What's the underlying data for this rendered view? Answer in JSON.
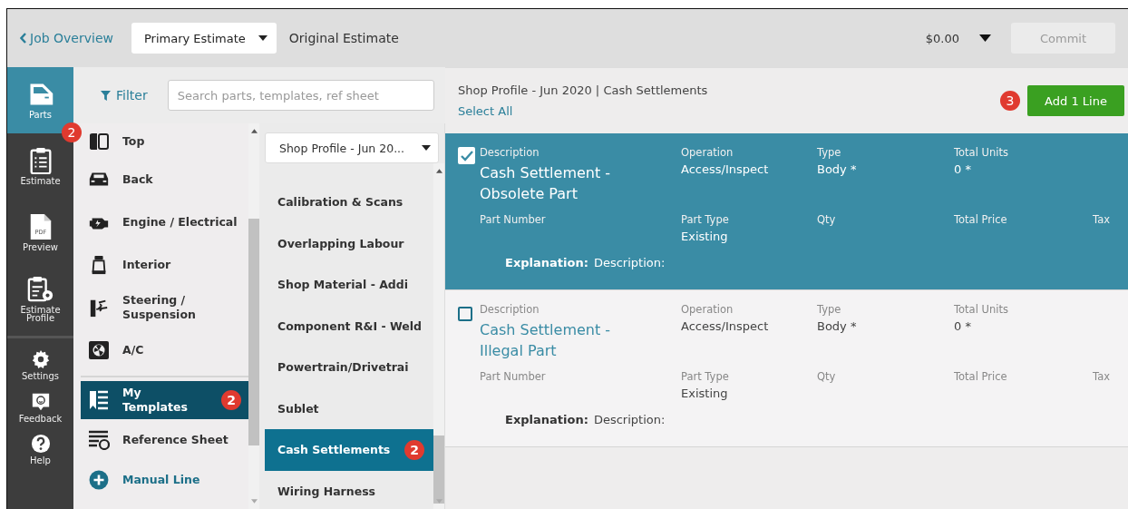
{
  "top_bar": {
    "back_link": "Job Overview",
    "estimate_select": "Primary Estimate",
    "estimate_title": "Original Estimate",
    "total": "$0.00",
    "commit_button": {
      "label": "Commit",
      "disabled": true
    }
  },
  "rail": [
    {
      "kind": "door",
      "label": "Parts",
      "selected": true,
      "badge": "2"
    },
    {
      "kind": "clipboard",
      "label": "Estimate",
      "selected": false
    },
    {
      "kind": "pdf",
      "label": "Preview",
      "selected": false,
      "icon_text": "PDF"
    },
    {
      "kind": "profile",
      "label": "Estimate Profile",
      "selected": false
    },
    {
      "kind": "gear",
      "label": "Settings",
      "selected": false
    },
    {
      "kind": "feedback",
      "label": "Feedback",
      "selected": false
    },
    {
      "kind": "help",
      "label": "Help",
      "selected": false
    }
  ],
  "filter": {
    "label": "Filter",
    "search_placeholder": "Search parts, templates, ref sheet"
  },
  "categories": [
    {
      "kind": "top",
      "label": "Top",
      "selected": false
    },
    {
      "kind": "back",
      "label": "Back",
      "selected": false
    },
    {
      "kind": "engine",
      "label": "Engine / Electrical",
      "selected": false
    },
    {
      "kind": "interior",
      "label": "Interior",
      "selected": false
    },
    {
      "kind": "steering",
      "label": "Steering / Suspension",
      "selected": false
    },
    {
      "kind": "ac",
      "label": "A/C",
      "selected": false
    }
  ],
  "sections": [
    {
      "kind": "templates",
      "label": "My Templates",
      "selected": true,
      "badge": "2"
    },
    {
      "kind": "reference",
      "label": "Reference Sheet",
      "selected": false
    },
    {
      "kind": "manual",
      "label": "Manual Line",
      "selected": false
    }
  ],
  "templates": {
    "profile_select": "Shop Profile - Jun 20...",
    "items": [
      {
        "label": "Calibration & Scans",
        "selected": false
      },
      {
        "label": "Overlapping Labour",
        "selected": false
      },
      {
        "label": "Shop Material - Addi",
        "selected": false
      },
      {
        "label": "Component R&I - Weld",
        "selected": false
      },
      {
        "label": "Powertrain/Drivetrai",
        "selected": false
      },
      {
        "label": "Sublet",
        "selected": false
      },
      {
        "label": "Cash Settlements",
        "selected": true,
        "badge": "2"
      },
      {
        "label": "Wiring Harness",
        "selected": false
      }
    ]
  },
  "main": {
    "breadcrumb": "Shop Profile - Jun 2020 | Cash Settlements",
    "select_all": "Select All",
    "badge": "3",
    "add_button": "Add 1 Line",
    "lines": [
      {
        "checked": true,
        "description_label": "Description",
        "description": "Cash Settlement - Obsolete Part",
        "operation_label": "Operation",
        "operation": "Access/Inspect",
        "type_label": "Type",
        "type": "Body *",
        "total_units_label": "Total Units",
        "total_units": "0 *",
        "part_number_label": "Part Number",
        "part_type_label": "Part Type",
        "part_type": "Existing",
        "qty_label": "Qty",
        "total_price_label": "Total Price",
        "tax_label": "Tax",
        "explanation_label": "Explanation:",
        "explanation": "Description:"
      },
      {
        "checked": false,
        "description_label": "Description",
        "description": "Cash Settlement - Illegal Part",
        "operation_label": "Operation",
        "operation": "Access/Inspect",
        "type_label": "Type",
        "type": "Body *",
        "total_units_label": "Total Units",
        "total_units": "0 *",
        "part_number_label": "Part Number",
        "part_type_label": "Part Type",
        "part_type": "Existing",
        "qty_label": "Qty",
        "total_price_label": "Total Price",
        "tax_label": "Tax",
        "explanation_label": "Explanation:",
        "explanation": "Description:"
      }
    ]
  }
}
